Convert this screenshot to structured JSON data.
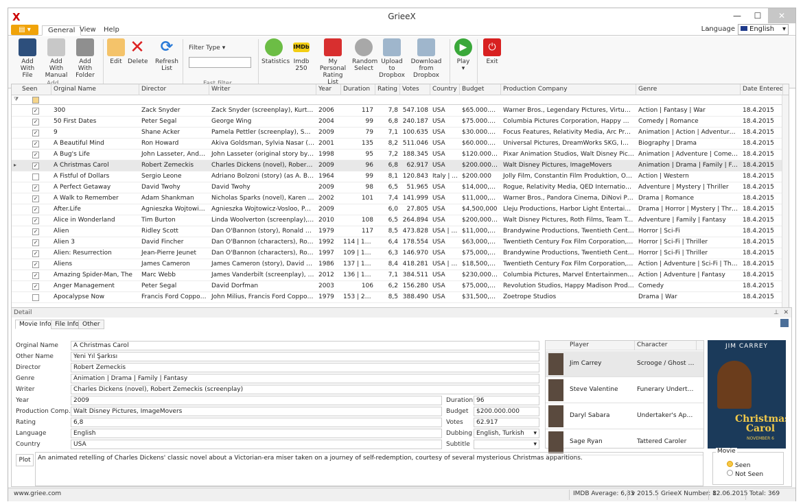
{
  "window": {
    "title": "GrieeX"
  },
  "ribbon_tabs": [
    "General",
    "View",
    "Help"
  ],
  "language": {
    "label": "Language",
    "value": "English"
  },
  "ribbon": {
    "add_with_file": "Add With\nFile",
    "add_with_manual": "Add With\nManual",
    "add_with_folder": "Add With\nFolder",
    "group_add": "Add",
    "edit": "Edit",
    "delete": "Delete",
    "refresh_list": "Refresh\nList",
    "filter_type": "Filter Type",
    "group_fast_filter": "Fast filter",
    "statistics": "Statistics",
    "imdb250": "Imdb 250",
    "imdb_badge": "IMDb",
    "my_personal_rating_list": "My Personal\nRating List",
    "random_select": "Random\nSelect",
    "upload_dropbox": "Upload to\nDropbox",
    "download_dropbox": "Download\nfrom Dropbox",
    "play": "Play",
    "exit": "Exit"
  },
  "grid": {
    "columns": [
      "Seen",
      "Orginal Name",
      "Director",
      "Writer",
      "Year",
      "Duration",
      "Rating",
      "Votes",
      "Country",
      "Budget",
      "Production Company",
      "Genre",
      "Date Entered"
    ],
    "rows": [
      {
        "seen": true,
        "name": "300",
        "director": "Zack Snyder",
        "writer": "Zack Snyder (screenplay), Kurt Johnsta...",
        "year": "2006",
        "duration": "117",
        "rating": "7,8",
        "votes": "547.108",
        "country": "USA",
        "budget": "$65.000.000",
        "company": "Warner Bros., Legendary Pictures, Virtual Studios",
        "genre": "Action | Fantasy | War",
        "date": "18.4.2015"
      },
      {
        "seen": true,
        "name": "50 First Dates",
        "director": "Peter Segal",
        "writer": "George Wing",
        "year": "2004",
        "duration": "99",
        "rating": "6,8",
        "votes": "240.187",
        "country": "USA",
        "budget": "$75.000.000",
        "company": "Columbia Pictures Corporation, Happy Madison Pro...",
        "genre": "Comedy | Romance",
        "date": "18.4.2015"
      },
      {
        "seen": true,
        "name": "9",
        "director": "Shane Acker",
        "writer": "Pamela Pettler (screenplay), Shane Ack...",
        "year": "2009",
        "duration": "79",
        "rating": "7,1",
        "votes": "100.635",
        "country": "USA",
        "budget": "$30.000.000",
        "company": "Focus Features, Relativity Media, Arc Productions",
        "genre": "Animation | Action | Adventure | Dram...",
        "date": "18.4.2015"
      },
      {
        "seen": true,
        "name": "A Beautiful Mind",
        "director": "Ron Howard",
        "writer": "Akiva Goldsman, Sylvia Nasar (book)",
        "year": "2001",
        "duration": "135",
        "rating": "8,2",
        "votes": "511.046",
        "country": "USA",
        "budget": "$60.000.000",
        "company": "Universal Pictures, DreamWorks SKG, Imagine Ent...",
        "genre": "Biography | Drama",
        "date": "18.4.2015"
      },
      {
        "seen": true,
        "name": "A Bug's Life",
        "director": "John Lasseter, Andrew ...",
        "writer": "John Lasseter (original story by), Andr...",
        "year": "1998",
        "duration": "95",
        "rating": "7,2",
        "votes": "188.345",
        "country": "USA",
        "budget": "$120.000.000",
        "company": "Pixar Animation Studios, Walt Disney Pictures",
        "genre": "Animation | Adventure | Comedy | Fa...",
        "date": "18.4.2015"
      },
      {
        "seen": true,
        "name": "A Christmas Carol",
        "director": "Robert Zemeckis",
        "writer": "Charles Dickens (novel), Robert Zemec...",
        "year": "2009",
        "duration": "96",
        "rating": "6,8",
        "votes": "62.917",
        "country": "USA",
        "budget": "$200.000.000",
        "company": "Walt Disney Pictures, ImageMovers",
        "genre": "Animation | Drama | Family | Fantasy",
        "date": "18.4.2015",
        "selected": true
      },
      {
        "seen": false,
        "name": "A Fistful of Dollars",
        "director": "Sergio Leone",
        "writer": "Adriano Bolzoni (story) (as A. Bonzzoni)...",
        "year": "1964",
        "duration": "99",
        "rating": "8,1",
        "votes": "120.843",
        "country": "Italy | ...",
        "budget": "$200.000",
        "company": "Jolly Film, Constantin Film Produktion, Ocean Films",
        "genre": "Action | Western",
        "date": "18.4.2015"
      },
      {
        "seen": true,
        "name": "A Perfect Getaway",
        "director": "David Twohy",
        "writer": "David Twohy",
        "year": "2009",
        "duration": "98",
        "rating": "6,5",
        "votes": "51.965",
        "country": "USA",
        "budget": "$14,000,000",
        "company": "Rogue, Relativity Media, QED International",
        "genre": "Adventure | Mystery | Thriller",
        "date": "18.4.2015"
      },
      {
        "seen": true,
        "name": "A Walk to Remember",
        "director": "Adam Shankman",
        "writer": "Nicholas Sparks (novel), Karen Janszen...",
        "year": "2002",
        "duration": "101",
        "rating": "7,4",
        "votes": "141.999",
        "country": "USA",
        "budget": "$11,000,000",
        "company": "Warner Bros., Pandora Cinema, DiNovi Pictures",
        "genre": "Drama | Romance",
        "date": "18.4.2015"
      },
      {
        "seen": true,
        "name": "After.Life",
        "director": "Agnieszka Wojtowicz-Vo...",
        "writer": "Agnieszka Wojtowicz-Vosloo, Paul Vosloo",
        "year": "2009",
        "duration": "",
        "rating": "6,0",
        "votes": "27.805",
        "country": "USA",
        "budget": "$4,500,000",
        "company": "Lleju Productions, Harbor Light Entertainment, Plu...",
        "genre": "Drama | Horror | Mystery | Thriller",
        "date": "18.4.2015"
      },
      {
        "seen": true,
        "name": "Alice in Wonderland",
        "director": "Tim Burton",
        "writer": "Linda Woolverton (screenplay), Lewis C...",
        "year": "2010",
        "duration": "108",
        "rating": "6,5",
        "votes": "264.894",
        "country": "USA",
        "budget": "$200,000,000",
        "company": "Walt Disney Pictures, Roth Films, Team Todd",
        "genre": "Adventure | Family | Fantasy",
        "date": "18.4.2015"
      },
      {
        "seen": true,
        "name": "Alien",
        "director": "Ridley Scott",
        "writer": "Dan O'Bannon (story), Ronald Shusett ...",
        "year": "1979",
        "duration": "117",
        "rating": "8,5",
        "votes": "473.828",
        "country": "USA | UK",
        "budget": "$11,000,000",
        "company": "Brandywine Productions, Twentieth Century-Fox P...",
        "genre": "Horror | Sci-Fi",
        "date": "18.4.2015"
      },
      {
        "seen": true,
        "name": "Alien 3",
        "director": "David Fincher",
        "writer": "Dan O'Bannon (characters), Ronald Sh...",
        "year": "1992",
        "duration": "114 | 14...",
        "rating": "6,4",
        "votes": "178.554",
        "country": "USA",
        "budget": "$63,000,000",
        "company": "Twentieth Century Fox Film Corporation, Brandywi...",
        "genre": "Horror | Sci-Fi | Thriller",
        "date": "18.4.2015"
      },
      {
        "seen": true,
        "name": "Alien: Resurrection",
        "director": "Jean-Pierre Jeunet",
        "writer": "Dan O'Bannon (characters), Ronald Sh...",
        "year": "1997",
        "duration": "109 | 11...",
        "rating": "6,3",
        "votes": "146.970",
        "country": "USA",
        "budget": "$75,000,000",
        "company": "Brandywine Productions, Twentieth Century Fox Fil...",
        "genre": "Horror | Sci-Fi | Thriller",
        "date": "18.4.2015"
      },
      {
        "seen": true,
        "name": "Aliens",
        "director": "James Cameron",
        "writer": "James Cameron (story), David Giler (st...",
        "year": "1986",
        "duration": "137 | 15...",
        "rating": "8,4",
        "votes": "418.281",
        "country": "USA | UK",
        "budget": "$18,500,000",
        "company": "Twentieth Century Fox Film Corporation, Brandywi...",
        "genre": "Action | Adventure | Sci-Fi | Thriller",
        "date": "18.4.2015"
      },
      {
        "seen": true,
        "name": "Amazing Spider-Man, The",
        "director": "Marc Webb",
        "writer": "James Vanderbilt (screenplay), Alvin Sa...",
        "year": "2012",
        "duration": "136 | 15...",
        "rating": "7,1",
        "votes": "384.511",
        "country": "USA",
        "budget": "$230,000,000",
        "company": "Columbia Pictures, Marvel Entertainment, Laura Zis...",
        "genre": "Action | Adventure | Fantasy",
        "date": "18.4.2015"
      },
      {
        "seen": true,
        "name": "Anger Management",
        "director": "Peter Segal",
        "writer": "David Dorfman",
        "year": "2003",
        "duration": "106",
        "rating": "6,2",
        "votes": "156.280",
        "country": "USA",
        "budget": "$75,000,000",
        "company": "Revolution Studios, Happy Madison Productions, A...",
        "genre": "Comedy",
        "date": "18.4.2015"
      },
      {
        "seen": false,
        "name": "Apocalypse Now",
        "director": "Francis Ford Coppola (a...",
        "writer": "John Milius, Francis Ford Coppola (as Fr...",
        "year": "1979",
        "duration": "153 | 20...",
        "rating": "8,5",
        "votes": "388.490",
        "country": "USA",
        "budget": "$31,500,000",
        "company": "Zoetrope Studios",
        "genre": "Drama | War",
        "date": "18.4.2015"
      }
    ]
  },
  "detail": {
    "header": "Detail",
    "tabs": [
      "Movie Info",
      "File Info",
      "Other"
    ],
    "fields": {
      "original_name": {
        "label": "Orginal Name",
        "value": "A Christmas Carol"
      },
      "other_name": {
        "label": "Other Name",
        "value": "Yeni Yıl Şarkısı"
      },
      "director": {
        "label": "Director",
        "value": "Robert Zemeckis"
      },
      "genre": {
        "label": "Genre",
        "value": "Animation | Drama | Family | Fantasy"
      },
      "writer": {
        "label": "Writer",
        "value": "Charles Dickens (novel), Robert Zemeckis (screenplay)"
      },
      "year": {
        "label": "Year",
        "value": "2009"
      },
      "production": {
        "label": "Production Comp...",
        "value": "Walt Disney Pictures, ImageMovers"
      },
      "rating": {
        "label": "Rating",
        "value": "6,8"
      },
      "language": {
        "label": "Language",
        "value": "English"
      },
      "country": {
        "label": "Country",
        "value": "USA"
      },
      "duration": {
        "label": "Duration",
        "value": "96"
      },
      "budget": {
        "label": "Budget",
        "value": "$200.000.000"
      },
      "votes": {
        "label": "Votes",
        "value": "62.917"
      },
      "dubbing": {
        "label": "Dubbing",
        "value": "English, Turkish"
      },
      "subtitle": {
        "label": "Subtitle",
        "value": ""
      }
    },
    "cast_headers": [
      "Player",
      "Character"
    ],
    "cast": [
      {
        "player": "Jim Carrey",
        "character": "Scrooge / Ghost of ..."
      },
      {
        "player": "Steve Valentine",
        "character": "Funerary Undertake..."
      },
      {
        "player": "Daryl Sabara",
        "character": "Undertaker's Appren..."
      },
      {
        "player": "Sage Ryan",
        "character": "Tattered Caroler"
      }
    ],
    "poster": {
      "top": "JIM CARREY",
      "title": "Christmas\nCarol",
      "subtitle": "NOVEMBER 6"
    },
    "plot_label": "Plot",
    "plot": "An animated retelling of Charles Dickens' classic novel about a Victorian-era miser taken on a journey of self-redemption, courtesy of several mysterious Christmas apparitions.",
    "movie_group": {
      "label": "Movie",
      "seen": "Seen",
      "not_seen": "Not Seen"
    }
  },
  "status": {
    "site": "www.griee.com",
    "imdb_avg": "IMDB Average: 6,83",
    "version": "v 2015.5",
    "grieex_number": "GrieeX Number: 8",
    "date": "12.06.2015",
    "total": "Total: 369"
  }
}
